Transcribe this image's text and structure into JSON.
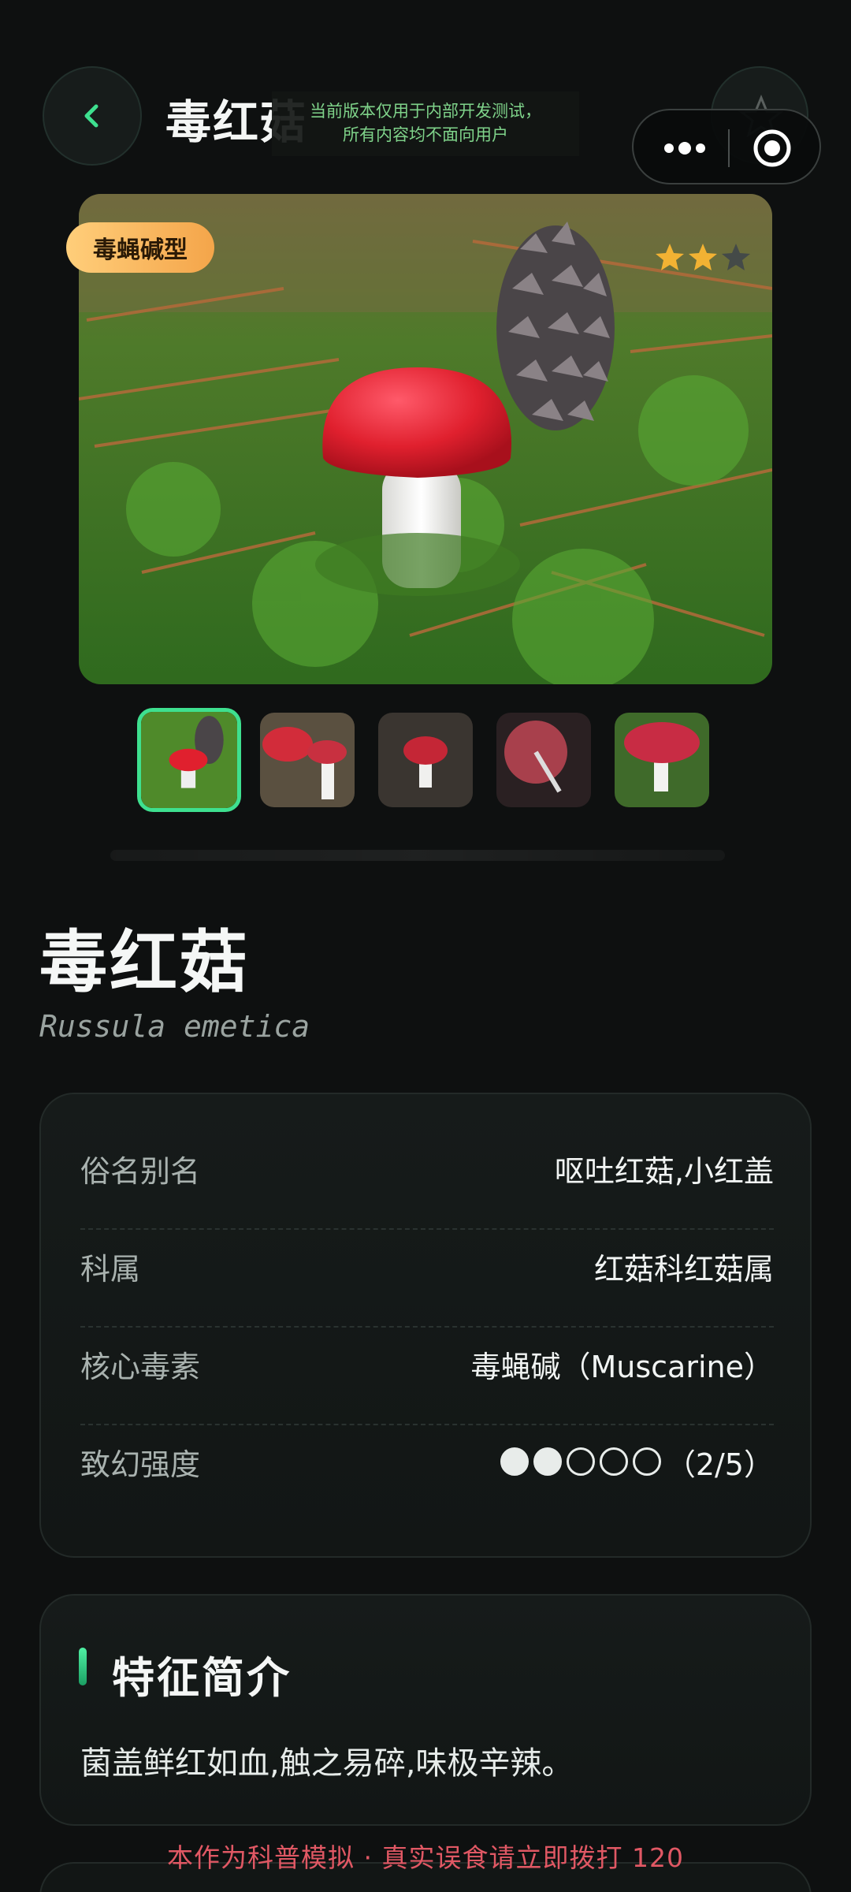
{
  "header": {
    "title": "毒红菇",
    "back_icon": "chevron-left-icon",
    "favorite_icon": "star-outline-icon",
    "dev_notice_line1": "当前版本仅用于内部开发测试，",
    "dev_notice_line2": "所有内容均不面向用户",
    "capsule": {
      "more_icon": "more-dots-icon",
      "close_icon": "target-circle-icon"
    }
  },
  "hero": {
    "badge": "毒蝇碱型",
    "stars_filled": 2,
    "stars_total": 3
  },
  "thumbnails": {
    "count": 5,
    "active_index": 0
  },
  "species": {
    "name": "毒红菇",
    "latin": "Russula emetica"
  },
  "info": {
    "rows": [
      {
        "key": "俗名别名",
        "value": "呕吐红菇,小红盖"
      },
      {
        "key": "科属",
        "value": "红菇科红菇属"
      },
      {
        "key": "核心毒素",
        "value": "毒蝇碱（Muscarine）"
      },
      {
        "key": "致幻强度",
        "value": "（2/5）",
        "rating": 2,
        "rating_max": 5
      }
    ]
  },
  "feature": {
    "title": "特征简介",
    "text": "菌盖鲜红如血,触之易碎,味极辛辣。"
  },
  "footer": {
    "note": "本作为科普模拟 · 真实误食请立即拨打 120"
  },
  "colors": {
    "background": "#0e1010",
    "accent_green": "#3ee08f",
    "badge_orange": "#f4a54a",
    "warning_red": "#e05864"
  }
}
